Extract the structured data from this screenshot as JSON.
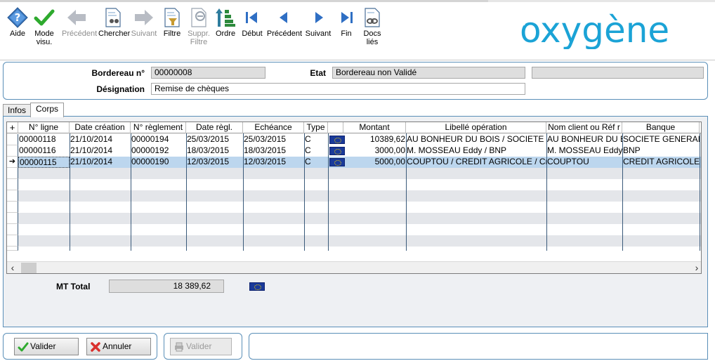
{
  "toolbar": {
    "items": [
      {
        "label": "Aide",
        "icon": "help-icon",
        "enabled": true
      },
      {
        "label": "Mode visu.",
        "icon": "check-icon",
        "enabled": true
      },
      {
        "label": "Précédent",
        "icon": "arrow-left-icon",
        "enabled": false
      },
      {
        "label": "Chercher",
        "icon": "search-document-icon",
        "enabled": true
      },
      {
        "label": "Suivant",
        "icon": "arrow-right-icon",
        "enabled": false
      },
      {
        "label": "Filtre",
        "icon": "filter-icon",
        "enabled": true
      },
      {
        "label": "Suppr. Filtre",
        "icon": "remove-filter-icon",
        "enabled": false
      },
      {
        "label": "Ordre",
        "icon": "sort-icon",
        "enabled": true
      },
      {
        "label": "Début",
        "icon": "first-record-icon",
        "enabled": true
      },
      {
        "label": "Précédent",
        "icon": "prev-record-icon",
        "enabled": true
      },
      {
        "label": "Suivant",
        "icon": "next-record-icon",
        "enabled": true
      },
      {
        "label": "Fin",
        "icon": "last-record-icon",
        "enabled": true
      },
      {
        "label": "Docs liés",
        "icon": "linked-docs-icon",
        "enabled": true
      }
    ]
  },
  "logo": {
    "text": "oxygène",
    "color": "#1ba3d6"
  },
  "header": {
    "bordereau_label": "Bordereau n°",
    "bordereau_value": "00000008",
    "etat_label": "Etat",
    "etat_value": "Bordereau non Validé",
    "extra_value": "",
    "designation_label": "Désignation",
    "designation_value": "Remise de chèques"
  },
  "tabs": [
    {
      "label": "Infos",
      "active": false
    },
    {
      "label": "Corps",
      "active": true
    }
  ],
  "grid": {
    "add_icon": "+",
    "columns": [
      "N° ligne",
      "Date création",
      "N° règlement",
      "Date règl.",
      "Echéance",
      "Type",
      "",
      "Montant",
      "Libellé opération",
      "Nom client ou Réf r",
      "Banque",
      ""
    ],
    "rows": [
      {
        "ligne": "00000118",
        "creation": "21/10/2014",
        "reglement": "00000194",
        "date_regl": "25/03/2015",
        "echeance": "25/03/2015",
        "type": "C",
        "currency_icon": "euro-flag-icon",
        "montant": "10389,62",
        "libelle": "AU BONHEUR DU BOIS / SOCIETE G",
        "client": "AU BONHEUR DU BOIS",
        "banque": "SOCIETE GENERALE",
        "extra": "I",
        "selected": false
      },
      {
        "ligne": "00000116",
        "creation": "21/10/2014",
        "reglement": "00000192",
        "date_regl": "18/03/2015",
        "echeance": "18/03/2015",
        "type": "C",
        "currency_icon": "euro-flag-icon",
        "montant": "3000,00",
        "libelle": "M. MOSSEAU Eddy / BNP",
        "client": "M. MOSSEAU Eddy",
        "banque": "BNP",
        "extra": "I",
        "selected": false
      },
      {
        "ligne": "00000115",
        "creation": "21/10/2014",
        "reglement": "00000190",
        "date_regl": "12/03/2015",
        "echeance": "12/03/2015",
        "type": "C",
        "currency_icon": "euro-flag-icon",
        "montant": "5000,00",
        "libelle": "COUPTOU / CREDIT AGRICOLE / Cr",
        "client": "COUPTOU",
        "banque": "CREDIT AGRICOLE",
        "extra": "I",
        "selected": true
      }
    ]
  },
  "total": {
    "label": "MT Total",
    "value": "18 389,62",
    "currency_icon": "euro-flag-icon"
  },
  "buttons": {
    "valider": "Valider",
    "annuler": "Annuler",
    "valider_disabled": "Valider"
  },
  "colors": {
    "accent": "#5a8fb8",
    "selected_row": "#bcd6ee",
    "logo": "#1ba3d6"
  }
}
